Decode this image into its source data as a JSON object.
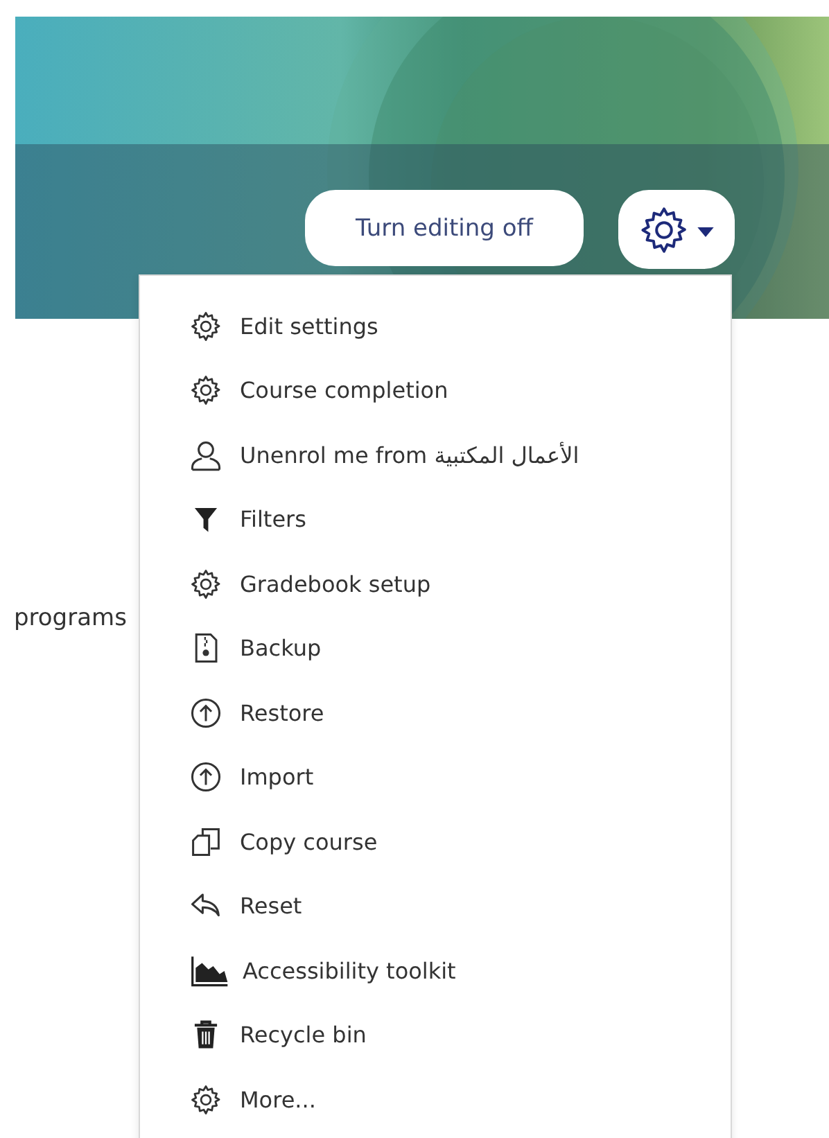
{
  "header": {
    "edit_button": "Turn editing off"
  },
  "body_text": "programs",
  "menu": {
    "items": [
      {
        "kind": "gear",
        "label": "Edit settings"
      },
      {
        "kind": "gear",
        "label": "Course completion"
      },
      {
        "kind": "person",
        "label": "Unenrol me from الأعمال المكتبية"
      },
      {
        "kind": "filter",
        "label": "Filters"
      },
      {
        "kind": "gear",
        "label": "Gradebook setup"
      },
      {
        "kind": "zip",
        "label": "Backup"
      },
      {
        "kind": "upload",
        "label": "Restore"
      },
      {
        "kind": "upload",
        "label": "Import"
      },
      {
        "kind": "copy",
        "label": "Copy course"
      },
      {
        "kind": "reply",
        "label": "Reset"
      },
      {
        "kind": "chart",
        "label": "Accessibility toolkit"
      },
      {
        "kind": "trash",
        "label": "Recycle bin"
      },
      {
        "kind": "gear",
        "label": "More..."
      }
    ]
  }
}
